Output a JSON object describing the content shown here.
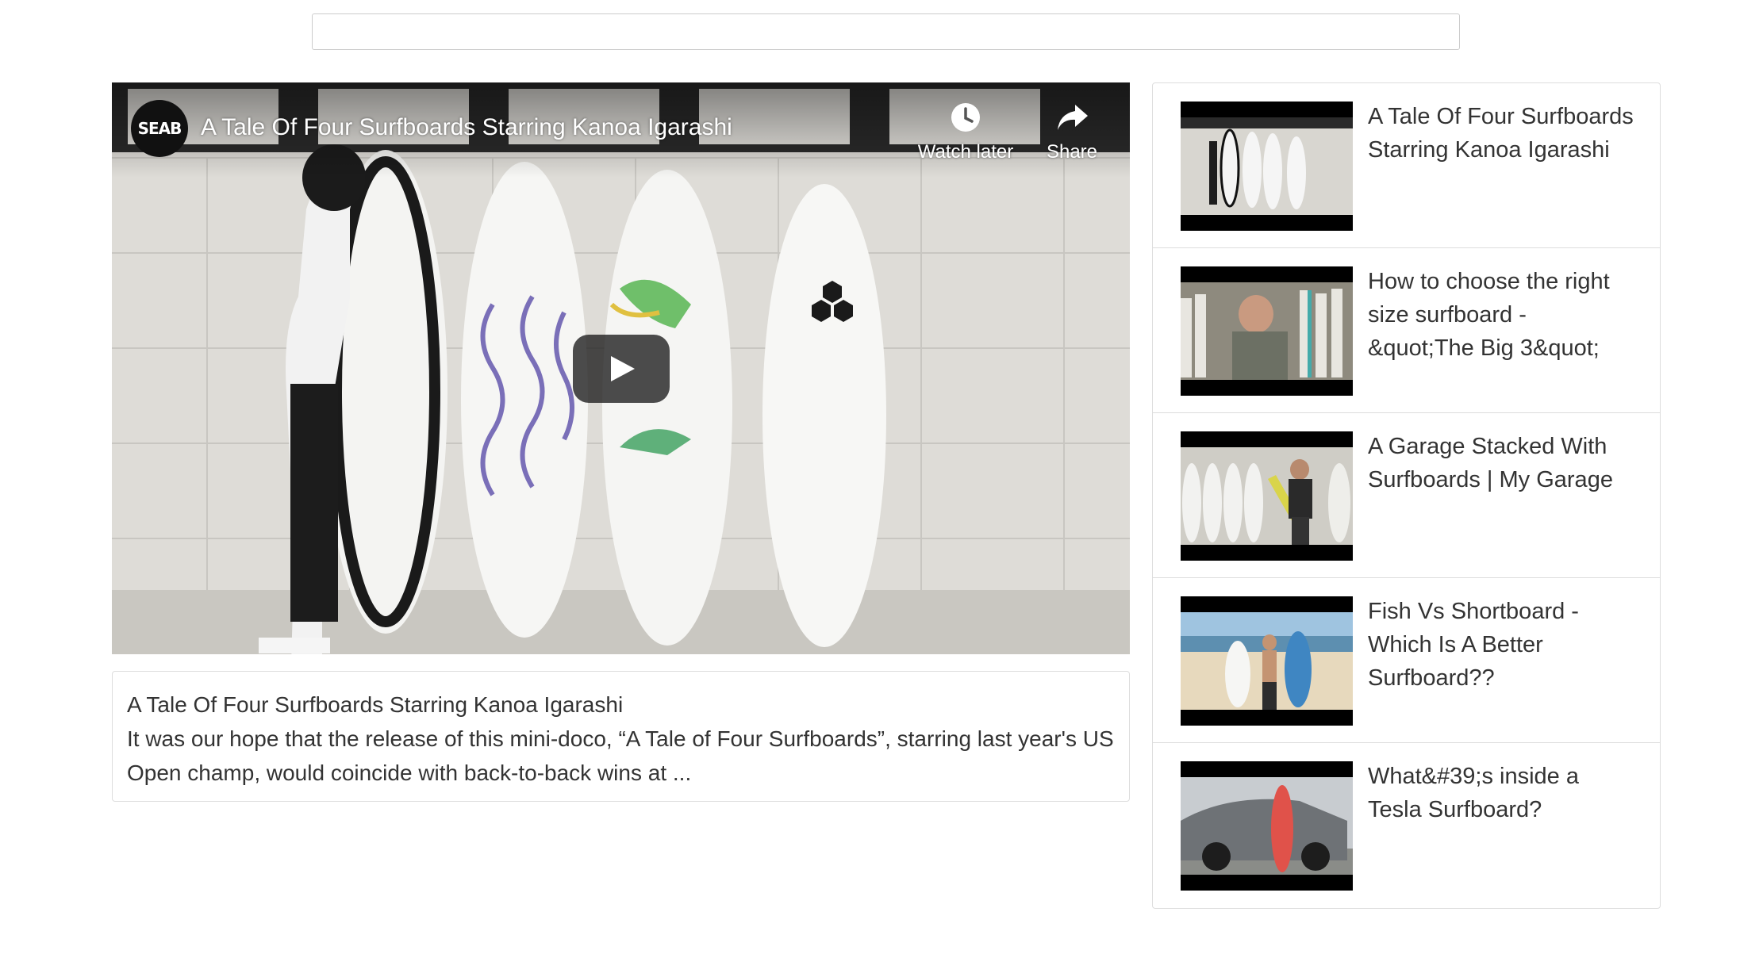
{
  "search": {
    "value": "",
    "placeholder": ""
  },
  "player": {
    "channel_logo_text": "SEAB",
    "title": "A Tale Of Four Surfboards Starring Kanoa Igarashi",
    "actions": [
      {
        "label": "Watch later",
        "icon": "clock-icon"
      },
      {
        "label": "Share",
        "icon": "share-arrow-icon"
      }
    ],
    "play_icon": "play-icon"
  },
  "description": {
    "title": "A Tale Of Four Surfboards Starring Kanoa Igarashi",
    "text": "It was our hope that the release of this mini-doco, “A Tale of Four Surfboards”, starring last year's US Open champ, would coincide with back-to-back wins at ..."
  },
  "playlist": {
    "items": [
      {
        "title": "A Tale Of Four Surfboards Starring Kanoa Igarashi"
      },
      {
        "title": "How to choose the right size surfboard - &quot;The Big 3&quot;"
      },
      {
        "title": "A Garage Stacked With Surfboards | My Garage"
      },
      {
        "title": "Fish Vs Shortboard - Which Is A Better Surfboard??"
      },
      {
        "title": "What&#39;s inside a Tesla Surfboard?"
      }
    ]
  },
  "colors": {
    "border": "#dddddd",
    "text": "#333333",
    "play_button_bg": "#212121"
  }
}
